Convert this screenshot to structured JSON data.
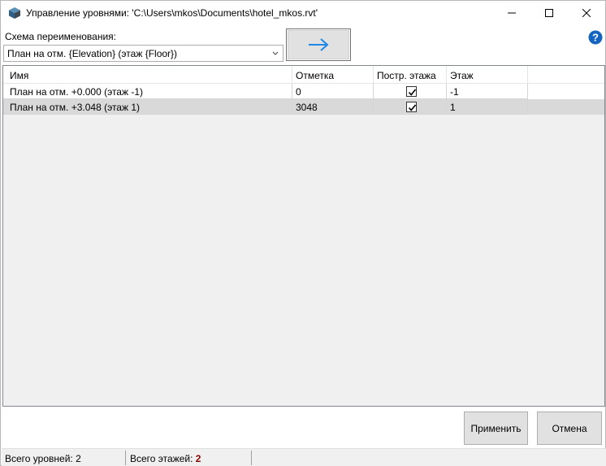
{
  "window": {
    "title": "Управление уровнями: 'C:\\Users\\mkos\\Documents\\hotel_mkos.rvt'"
  },
  "scheme": {
    "label": "Схема переименования:",
    "value": "План на отм. {Elevation} (этаж {Floor})"
  },
  "grid": {
    "columns": [
      "Имя",
      "Отметка",
      "Постр. этажа",
      "Этаж"
    ],
    "rows": [
      {
        "name": "План на отм. +0.000 (этаж -1)",
        "elevation": "0",
        "building_story": true,
        "floor": "-1"
      },
      {
        "name": "План на отм. +3.048 (этаж 1)",
        "elevation": "3048",
        "building_story": true,
        "floor": "1"
      }
    ]
  },
  "buttons": {
    "apply": "Применить",
    "cancel": "Отмена"
  },
  "status": {
    "levels_label": "Всего уровней:",
    "levels_count": "2",
    "floors_label": "Всего этажей:",
    "floors_count": "2"
  },
  "icons": {
    "app": "revit-app-icon",
    "arrow": "arrow-right-icon",
    "help": "help-icon"
  },
  "colors": {
    "accent": "#1e88e5",
    "selected_row": "#d9d9d9",
    "status_count": "#8b0000"
  }
}
